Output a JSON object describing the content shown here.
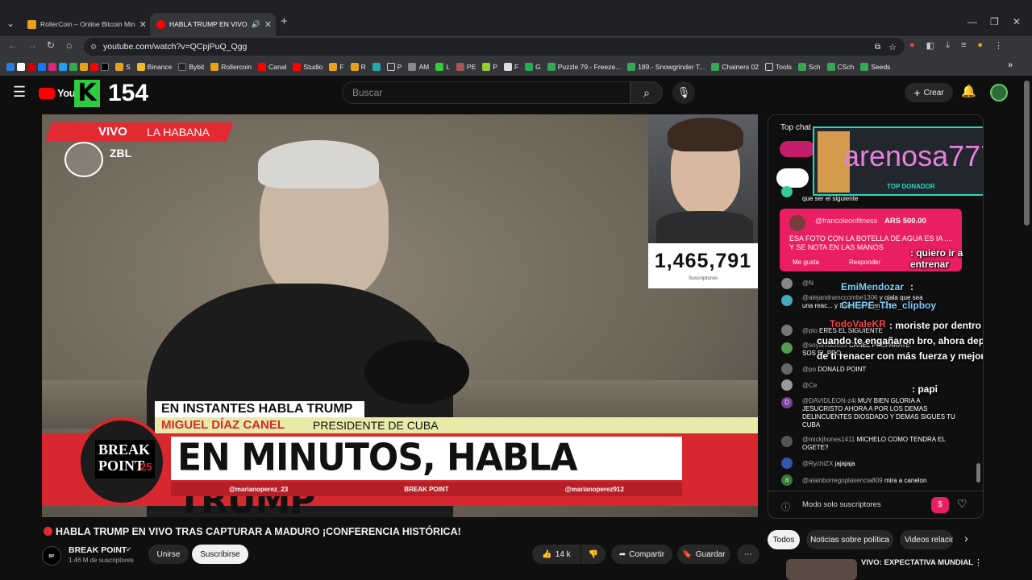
{
  "browser": {
    "tabs": [
      {
        "label": "RollerCoin – Online Bitcoin Min"
      },
      {
        "label": "HABLA TRUMP EN VIVO"
      }
    ],
    "url": "youtube.com/watch?v=QCpjPuQ_Qgg",
    "bookmarks": [
      "S",
      "Binance",
      "Bybit",
      "Rollercoin",
      "Canal",
      "Studio",
      "F",
      "R",
      "P",
      "AM",
      "L",
      "PE",
      "P",
      "F",
      "G",
      "Puzzle 79.- Freeze...",
      "189.- Snowgrinder T...",
      "Chainers 02",
      "Tools",
      "Sch",
      "CSch",
      "Seeds"
    ]
  },
  "youtube": {
    "logo": "YouTube",
    "counter": "154",
    "search_placeholder": "Buscar",
    "create_label": "Crear"
  },
  "video": {
    "vivo": "VIVO",
    "city": "LA HABANA",
    "channel_tag": "ZBL",
    "lower_third_1": "EN INSTANTES HABLA TRUMP",
    "name": "MIGUEL DÍAZ CANEL",
    "role": "PRESIDENTE DE CUBA",
    "banner": "EN MINUTOS, HABLA TRUMP",
    "brand_line1": "BREAK",
    "brand_line2": "POINT",
    "brand_num": "25",
    "social_1": "@marianoperez_23",
    "social_2": "BREAK POINT",
    "social_3": "@marianoperez912",
    "sub_count": "1,465,791",
    "sub_label": "Suscriptores",
    "title": "HABLA TRUMP EN VIVO TRAS CAPTURAR A MADURO ¡CONFERENCIA HISTÓRICA!",
    "channel": "BREAK POINT",
    "subscribers": "1.46 M de suscriptores",
    "join": "Unirse",
    "subscribe": "Suscribirse",
    "likes": "14 k",
    "share": "Compartir",
    "save": "Guardar"
  },
  "chat": {
    "header": "Top chat",
    "overlay_name": "arenosa777",
    "top_donor": "TOP DONADOR",
    "pinned_name": "@francoleonfitness",
    "pinned_amount": "ARS 500.00",
    "pinned_text": "ESA FOTO CON LA BOTELLA DE AGUA ES IA .... Y SE NOTA EN LAS MANOS",
    "like": "Me gusta",
    "reply": "Responder",
    "messages": [
      {
        "author": "",
        "text": "que ser el siguiente"
      },
      {
        "author": "@N",
        "text": ""
      },
      {
        "author": "@alejandramccombe1306",
        "text": "y ojala que sea una reac... y Diaz Canel en Cuba"
      },
      {
        "author": "@pio",
        "text": "ERES EL SIGUIENTE"
      },
      {
        "author": "@soyanita3693",
        "text": "CANEL PREPARATE SOS EL PRO"
      },
      {
        "author": "@po",
        "text": "DONALD POINT"
      },
      {
        "author": "@Ce",
        "text": ""
      },
      {
        "author": "@DAVIDLEON-z4i",
        "text": "MUY BIEN GLORIA A JESUCRISTO AHORA A POR LOS DEMAS DELINCUENTES DIOSDADO Y DEMAS SIGUES TU CUBA"
      },
      {
        "author": "@mickjhones1411",
        "text": "MICHELO COMO TENDRA EL OGETE?"
      },
      {
        "author": "@RychiZX",
        "text": "jajajaja"
      },
      {
        "author": "@alainborregoplasencia809",
        "text": "mira a canelon"
      }
    ],
    "overlay_msgs": [
      {
        "name": "",
        "text": ": quiero ir a entrenar"
      },
      {
        "name": "EmiMendozar",
        "text": ":"
      },
      {
        "name": "CHEPE_The_clipboy",
        "text": ""
      },
      {
        "name": "TodoValeKR",
        "text": ": moriste por dentro cuando te engañaron bro, ahora depende de ti renacer con más fuerza y mejorar"
      },
      {
        "name": "",
        "text": ": papi"
      }
    ],
    "footer": "Modo solo suscriptores",
    "chips": [
      "Todos",
      "Noticias sobre política",
      "Videos relacio"
    ],
    "next_title": "VIVO: EXPECTATIVA MUNDIAL"
  }
}
